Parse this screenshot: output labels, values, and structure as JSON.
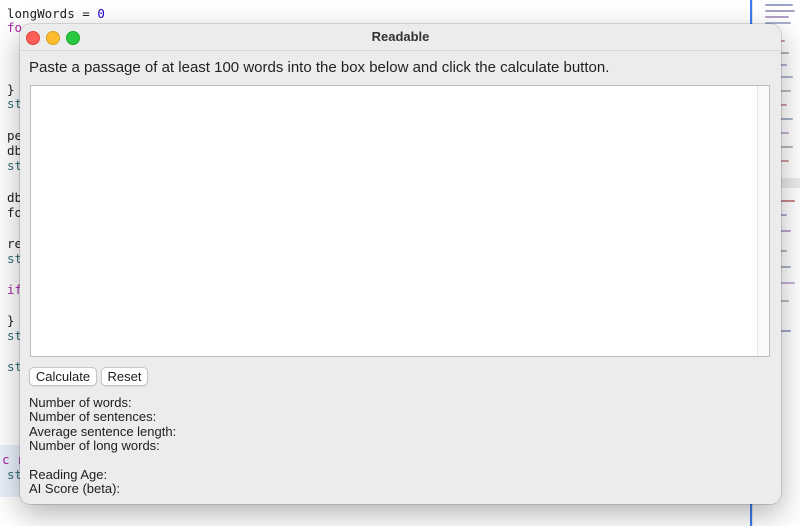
{
  "editor": {
    "lines": [
      {
        "segments": [
          {
            "text": "longWords = ",
            "cls": ""
          },
          {
            "text": "0",
            "cls": "num"
          }
        ]
      },
      {
        "segments": [
          {
            "text": "fo",
            "cls": "kw"
          }
        ]
      },
      {
        "segments": [
          {
            "text": "}",
            "cls": ""
          }
        ]
      },
      {
        "segments": [
          {
            "text": "st",
            "cls": "ident"
          }
        ]
      },
      {
        "segments": [
          {
            "text": "pe",
            "cls": ""
          }
        ]
      },
      {
        "segments": [
          {
            "text": "db",
            "cls": ""
          }
        ]
      },
      {
        "segments": [
          {
            "text": "st",
            "cls": "ident"
          }
        ]
      },
      {
        "segments": [
          {
            "text": "db",
            "cls": ""
          }
        ]
      },
      {
        "segments": [
          {
            "text": "fo",
            "cls": ""
          }
        ]
      },
      {
        "segments": [
          {
            "text": "re",
            "cls": ""
          }
        ]
      },
      {
        "segments": [
          {
            "text": "st",
            "cls": "ident"
          }
        ]
      },
      {
        "segments": [
          {
            "text": "if",
            "cls": "kw"
          }
        ]
      },
      {
        "segments": [
          {
            "text": "}",
            "cls": ""
          }
        ]
      },
      {
        "segments": [
          {
            "text": "st",
            "cls": "ident"
          }
        ]
      },
      {
        "segments": [
          {
            "text": "st",
            "cls": "ident"
          }
        ]
      },
      {
        "segments": [
          {
            "text": "c r",
            "cls": "kw"
          }
        ]
      },
      {
        "segments": [
          {
            "text": "st",
            "cls": "ident"
          }
        ]
      }
    ]
  },
  "window": {
    "title": "Readable",
    "instructions": "Paste a passage of at least 100 words into the box below and click the calculate button.",
    "text_input": {
      "value": "",
      "placeholder": ""
    },
    "buttons": {
      "calculate": "Calculate",
      "reset": "Reset"
    },
    "stats": {
      "words": "Number of words:",
      "sentences": "Number of sentences:",
      "avg_length": "Average sentence length:",
      "long_words": "Number of long words:",
      "reading_age": "Reading Age:",
      "ai_score": "AI Score (beta):"
    }
  },
  "colors": {
    "window_bg": "#ececec",
    "close": "#ff5f57",
    "minimize": "#febc2e",
    "maximize": "#28c840",
    "editor_divider": "#3b7cf0"
  }
}
